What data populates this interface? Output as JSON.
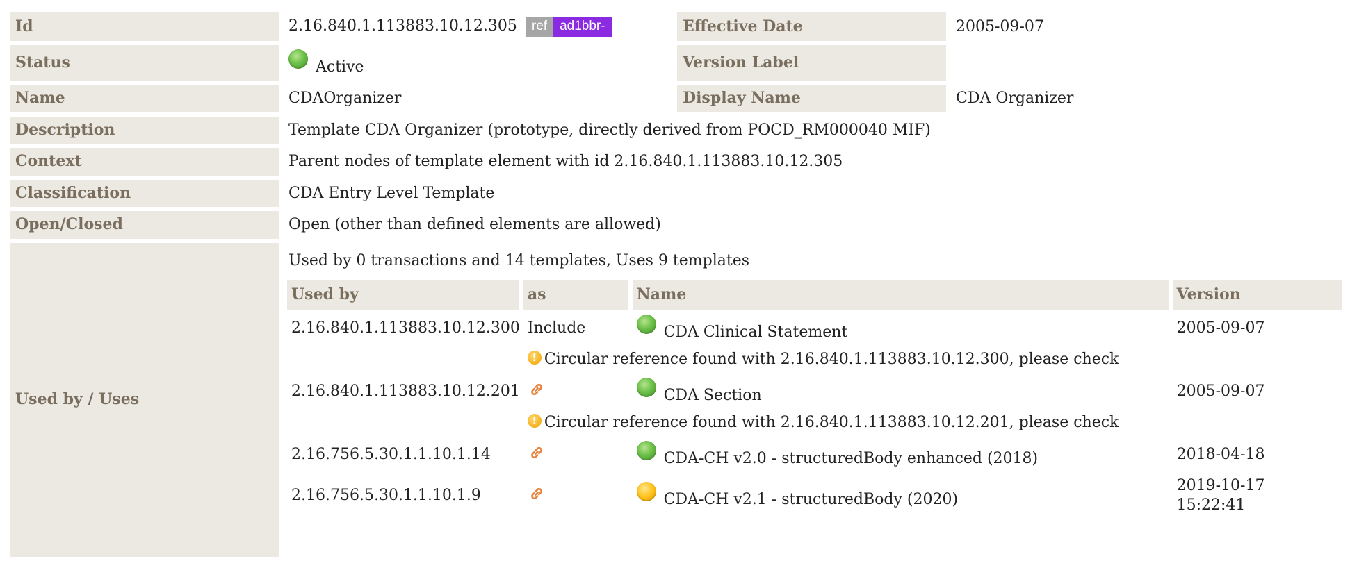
{
  "template": {
    "labels": {
      "id": "Id",
      "effective_date": "Effective Date",
      "status": "Status",
      "version_label": "Version Label",
      "name": "Name",
      "display_name": "Display Name",
      "description": "Description",
      "context": "Context",
      "classification": "Classification",
      "open_closed": "Open/Closed",
      "used_by_uses": "Used by / Uses"
    },
    "id": "2.16.840.1.113883.10.12.305",
    "ref_badge": "ref",
    "project_badge": "ad1bbr-",
    "effective_date": "2005-09-07",
    "status": "Active",
    "version_label": "",
    "name": "CDAOrganizer",
    "display_name": "CDA Organizer",
    "description": "Template CDA Organizer (prototype, directly derived from POCD_RM000040 MIF)",
    "context": "Parent nodes of template element with id 2.16.840.1.113883.10.12.305",
    "classification": "CDA Entry Level Template",
    "open_closed": "Open (other than defined elements are allowed)"
  },
  "usage": {
    "summary": "Used by 0 transactions and 14 templates, Uses 9 templates",
    "headers": {
      "used_by": "Used by",
      "as": "as",
      "name": "Name",
      "version": "Version"
    },
    "rows": [
      {
        "used_by": "2.16.840.1.113883.10.12.300",
        "as": "Include",
        "as_icon": "",
        "status": "green",
        "name": "CDA Clinical Statement",
        "version": "2005-09-07",
        "version_time": "",
        "warning": "Circular reference found with 2.16.840.1.113883.10.12.300, please check"
      },
      {
        "used_by": "2.16.840.1.113883.10.12.201",
        "as": "",
        "as_icon": "link-icon",
        "status": "green",
        "name": "CDA Section",
        "version": "2005-09-07",
        "version_time": "",
        "warning": "Circular reference found with 2.16.840.1.113883.10.12.201, please check"
      },
      {
        "used_by": "2.16.756.5.30.1.1.10.1.14",
        "as": "",
        "as_icon": "link-icon",
        "status": "green",
        "name": "CDA-CH v2.0 - structuredBody enhanced (2018)",
        "version": "2018-04-18",
        "version_time": "",
        "warning": ""
      },
      {
        "used_by": "2.16.756.5.30.1.1.10.1.9",
        "as": "",
        "as_icon": "link-icon",
        "status": "orange",
        "name": "CDA-CH v2.1 - structuredBody (2020)",
        "version": "2019-10-17",
        "version_time": "15:22:41",
        "warning": ""
      }
    ]
  },
  "colors": {
    "label_bg": "#ece9e2",
    "label_text": "#7a6e5f",
    "ref_badge": "#a6a6a6",
    "project_badge": "#8a2be2",
    "status_active": "#6cc04a",
    "status_draft": "#ffc21a",
    "warning": "#f0a200",
    "link_icon": "#e8823a"
  }
}
